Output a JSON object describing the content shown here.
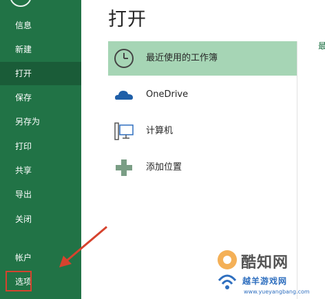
{
  "sidebar": {
    "items": [
      {
        "label": "信息"
      },
      {
        "label": "新建"
      },
      {
        "label": "打开"
      },
      {
        "label": "保存"
      },
      {
        "label": "另存为"
      },
      {
        "label": "打印"
      },
      {
        "label": "共享"
      },
      {
        "label": "导出"
      },
      {
        "label": "关闭"
      },
      {
        "label": "帐户"
      },
      {
        "label": "选项"
      }
    ],
    "active": "打开"
  },
  "main": {
    "title": "打开",
    "places": [
      {
        "label": "最近使用的工作簿",
        "icon": "clock-icon"
      },
      {
        "label": "OneDrive",
        "icon": "cloud-icon"
      },
      {
        "label": "计算机",
        "icon": "computer-icon"
      },
      {
        "label": "添加位置",
        "icon": "plus-icon"
      }
    ],
    "right_glyph": "最"
  },
  "watermark": {
    "name": "酷知网",
    "site": "越羊游戏网",
    "url": "www.yueyangbang.com"
  },
  "colors": {
    "sidebar_bg": "#217346",
    "sidebar_active": "#1a5c38",
    "selected_place": "#a6d5b5",
    "annotation_red": "#d6432e"
  }
}
